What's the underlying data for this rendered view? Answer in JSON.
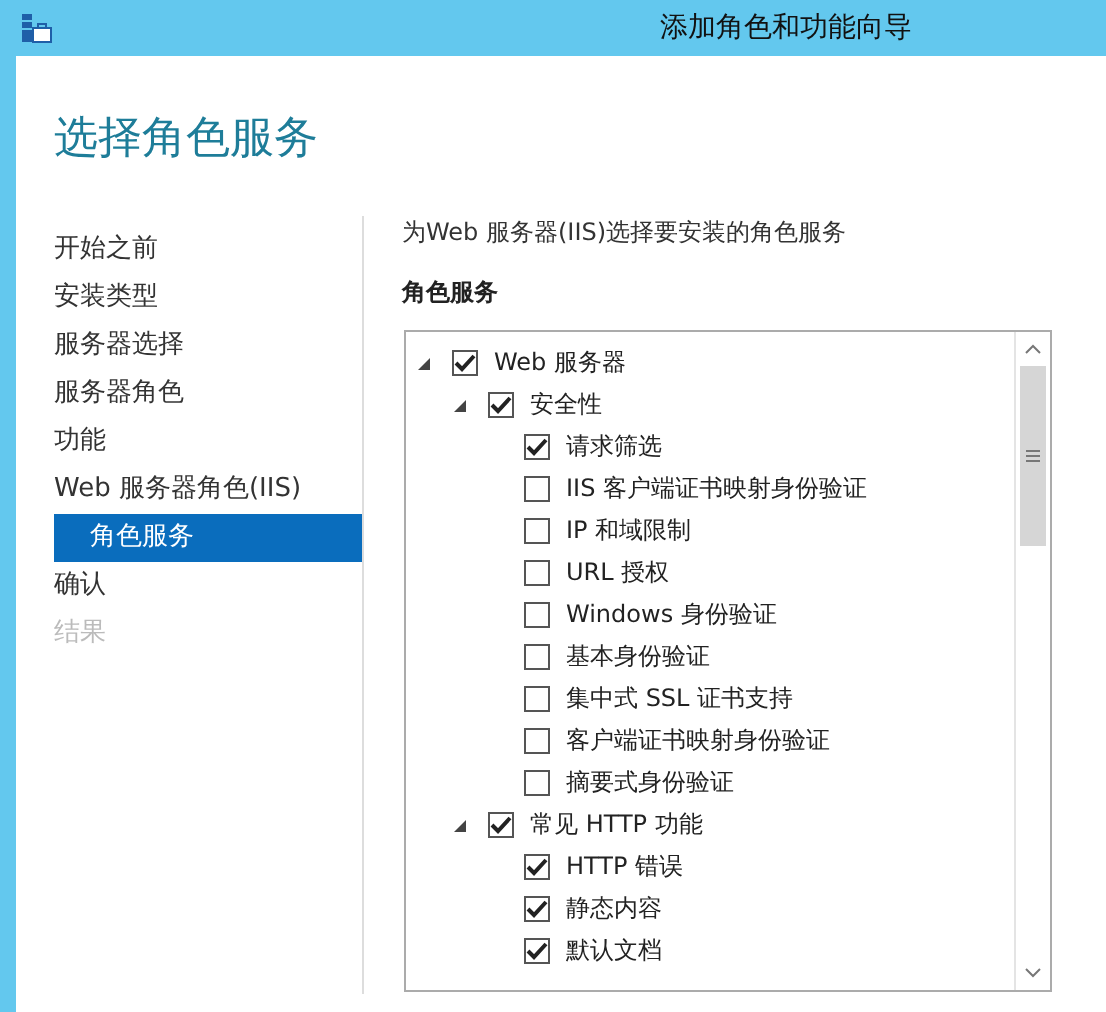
{
  "window": {
    "title": "添加角色和功能向导"
  },
  "heading": "选择角色服务",
  "sidebar": {
    "items": [
      {
        "label": "开始之前",
        "selected": false,
        "disabled": false
      },
      {
        "label": "安装类型",
        "selected": false,
        "disabled": false
      },
      {
        "label": "服务器选择",
        "selected": false,
        "disabled": false
      },
      {
        "label": "服务器角色",
        "selected": false,
        "disabled": false
      },
      {
        "label": "功能",
        "selected": false,
        "disabled": false
      },
      {
        "label": "Web 服务器角色(IIS)",
        "selected": false,
        "disabled": false,
        "children": [
          {
            "label": "角色服务",
            "selected": true,
            "disabled": false
          }
        ]
      },
      {
        "label": "确认",
        "selected": false,
        "disabled": false
      },
      {
        "label": "结果",
        "selected": false,
        "disabled": true
      }
    ]
  },
  "description": "为Web 服务器(IIS)选择要安装的角色服务",
  "section_title": "角色服务",
  "tree": [
    {
      "label": "Web 服务器",
      "checked": true,
      "expanded": true,
      "children": [
        {
          "label": "安全性",
          "checked": true,
          "expanded": true,
          "children": [
            {
              "label": "请求筛选",
              "checked": true
            },
            {
              "label": "IIS 客户端证书映射身份验证",
              "checked": false
            },
            {
              "label": "IP 和域限制",
              "checked": false
            },
            {
              "label": "URL 授权",
              "checked": false
            },
            {
              "label": "Windows 身份验证",
              "checked": false
            },
            {
              "label": "基本身份验证",
              "checked": false
            },
            {
              "label": "集中式 SSL 证书支持",
              "checked": false
            },
            {
              "label": "客户端证书映射身份验证",
              "checked": false
            },
            {
              "label": "摘要式身份验证",
              "checked": false
            }
          ]
        },
        {
          "label": "常见 HTTP 功能",
          "checked": true,
          "expanded": true,
          "children": [
            {
              "label": "HTTP 错误",
              "checked": true
            },
            {
              "label": "静态内容",
              "checked": true
            },
            {
              "label": "默认文档",
              "checked": true
            }
          ]
        }
      ]
    }
  ]
}
